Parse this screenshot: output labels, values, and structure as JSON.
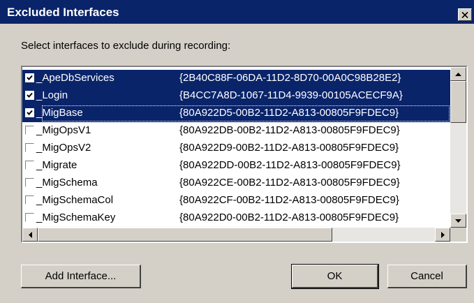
{
  "window": {
    "title": "Excluded Interfaces"
  },
  "instruction": "Select interfaces to exclude during recording:",
  "interfaces": [
    {
      "name": "_ApeDbServices",
      "guid": "{2B40C88F-06DA-11D2-8D70-00A0C98B28E2}",
      "checked": true,
      "selected": true
    },
    {
      "name": "_Login",
      "guid": "{B4CC7A8D-1067-11D4-9939-00105ACECF9A}",
      "checked": true,
      "selected": true
    },
    {
      "name": "_MigBase",
      "guid": "{80A922D5-00B2-11D2-A813-00805F9FDEC9}",
      "checked": true,
      "selected": true
    },
    {
      "name": "_MigOpsV1",
      "guid": "{80A922DB-00B2-11D2-A813-00805F9FDEC9}",
      "checked": false,
      "selected": false
    },
    {
      "name": "_MigOpsV2",
      "guid": "{80A922D9-00B2-11D2-A813-00805F9FDEC9}",
      "checked": false,
      "selected": false
    },
    {
      "name": "_Migrate",
      "guid": "{80A922DD-00B2-11D2-A813-00805F9FDEC9}",
      "checked": false,
      "selected": false
    },
    {
      "name": "_MigSchema",
      "guid": "{80A922CE-00B2-11D2-A813-00805F9FDEC9}",
      "checked": false,
      "selected": false
    },
    {
      "name": "_MigSchemaCol",
      "guid": "{80A922CF-00B2-11D2-A813-00805F9FDEC9}",
      "checked": false,
      "selected": false
    },
    {
      "name": "_MigSchemaKey",
      "guid": "{80A922D0-00B2-11D2-A813-00805F9FDEC9}",
      "checked": false,
      "selected": false
    }
  ],
  "buttons": {
    "add_interface": "Add Interface...",
    "ok": "OK",
    "cancel": "Cancel"
  },
  "colors": {
    "titlebar": "#0a246a",
    "selection": "#0a246a",
    "face": "#d4d0c8"
  },
  "icons": {
    "close": "close-icon",
    "check": "checkmark-icon",
    "scroll_up": "arrow-up-icon",
    "scroll_down": "arrow-down-icon",
    "scroll_left": "arrow-left-icon",
    "scroll_right": "arrow-right-icon"
  }
}
